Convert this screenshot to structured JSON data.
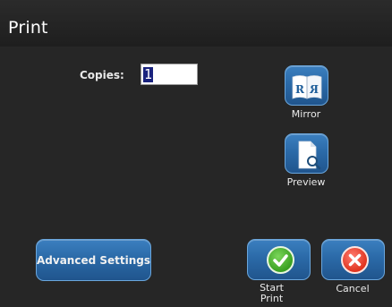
{
  "window": {
    "title": "Print"
  },
  "copies": {
    "label": "Copies:",
    "value": "1"
  },
  "buttons": {
    "mirror": {
      "label": "Mirror",
      "icon": "mirror-book-icon"
    },
    "preview": {
      "label": "Preview",
      "icon": "document-magnifier-icon"
    },
    "advanced": {
      "label": "Advanced Settings"
    },
    "start": {
      "label": "Start Print",
      "icon": "green-check-icon"
    },
    "cancel": {
      "label": "Cancel",
      "icon": "red-x-icon"
    }
  },
  "colors": {
    "background": "#262626",
    "title_bar": "#1e1e1e",
    "button_blue": "#2b6aa8",
    "selection": "#1a237e",
    "confirm_green": "#3aa022",
    "cancel_red": "#e0341f"
  }
}
